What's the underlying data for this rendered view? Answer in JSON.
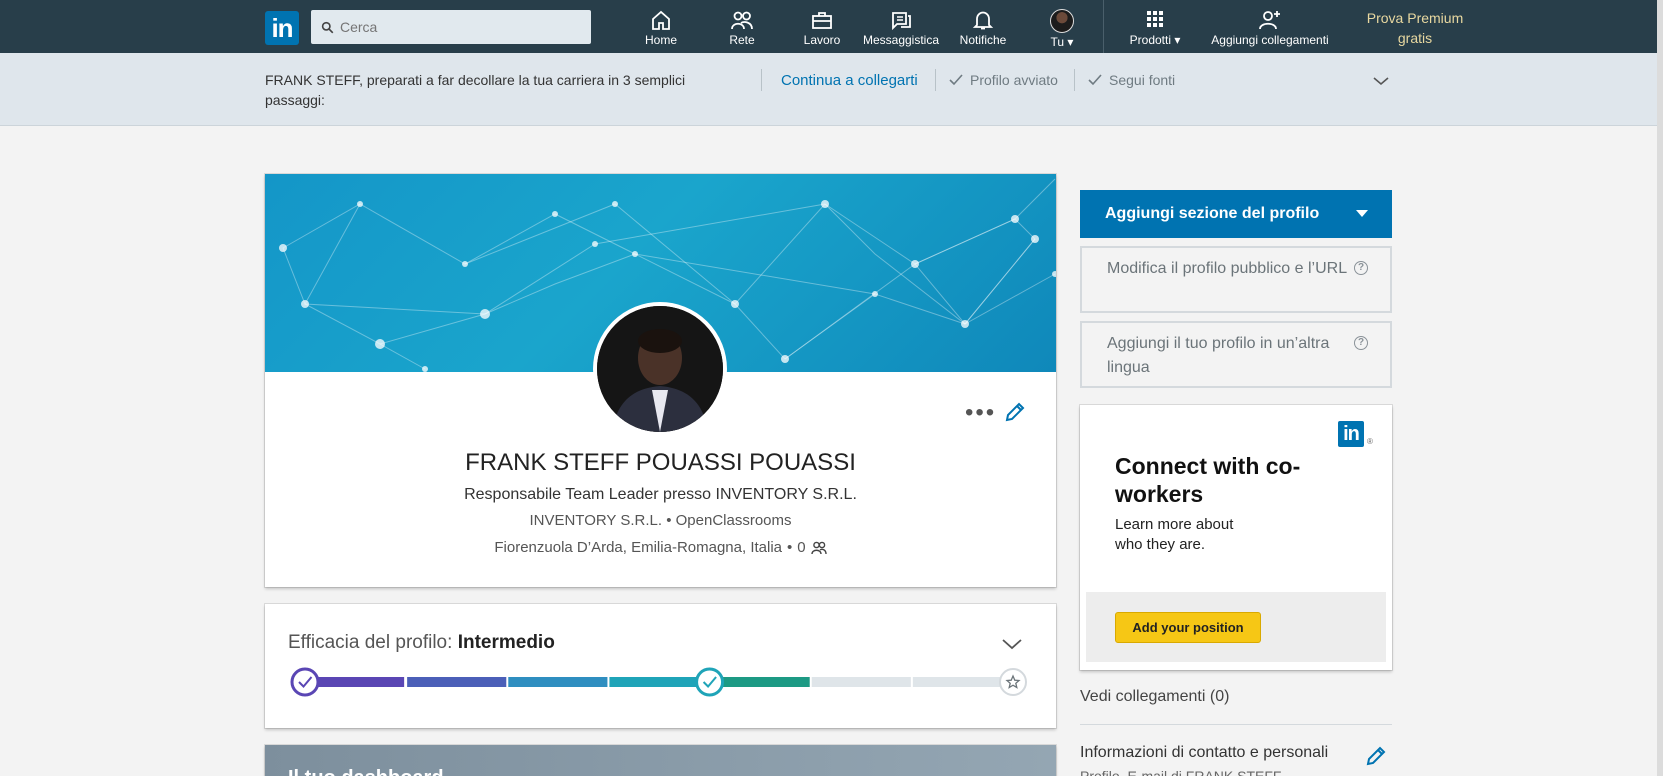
{
  "nav": {
    "search_placeholder": "Cerca",
    "items": [
      {
        "label": "Home",
        "icon": "home-icon"
      },
      {
        "label": "Rete",
        "icon": "network-icon"
      },
      {
        "label": "Lavoro",
        "icon": "briefcase-icon"
      },
      {
        "label": "Messaggistica",
        "icon": "messaging-icon"
      },
      {
        "label": "Notifiche",
        "icon": "bell-icon"
      },
      {
        "label": "Tu",
        "icon": "avatar"
      },
      {
        "label": "Prodotti",
        "icon": "grid-icon"
      },
      {
        "label": "Aggiungi collegamenti",
        "icon": "add-person-icon"
      }
    ],
    "premium_line1": "Prova Premium",
    "premium_line2": "gratis"
  },
  "onboarding": {
    "text": "FRANK STEFF, preparati a far decollare la tua carriera in 3 semplici passaggi:",
    "link": "Continua a collegarti",
    "step1": "Profilo avviato",
    "step2": "Segui fonti"
  },
  "profile": {
    "name": "FRANK STEFF POUASSI POUASSI",
    "headline": "Responsabile Team Leader presso INVENTORY S.R.L.",
    "company": "INVENTORY S.R.L.",
    "education": "OpenClassrooms",
    "location": "Fiorenzuola D’Arda, Emilia-Romagna, Italia",
    "connections": "0",
    "separator": "•",
    "more": "•••"
  },
  "strength": {
    "label": "Efficacia del profilo: ",
    "level": "Intermedio",
    "progress_segments_filled": 5,
    "progress_segments_total": 7,
    "colors": [
      "#5a46b4",
      "#4b5fb8",
      "#2f8ec0",
      "#1fa4b8",
      "#1d9a84",
      "#dfe5e9",
      "#dfe5e9"
    ]
  },
  "next_card": {
    "title": "Il tuo dashboard"
  },
  "rail": {
    "add_section": "Aggiungi sezione del profilo",
    "public_profile": "Modifica il profilo pubblico e l’URL",
    "other_language": "Aggiungi il tuo profilo in un’altra lingua",
    "ad": {
      "title": "Connect with co-workers",
      "subtitle": "Learn more about who they are.",
      "button": "Add your position",
      "logo": "in",
      "reg": "®"
    },
    "connections": "Vedi collegamenti (0)",
    "contact": "Informazioni di contatto e personali",
    "contact_sub": "Profilo, E-mail di FRANK STEFF"
  },
  "colors": {
    "nav_bg": "#283e4a",
    "brand_blue": "#0073b1",
    "premium_gold": "#e8d8a0"
  }
}
